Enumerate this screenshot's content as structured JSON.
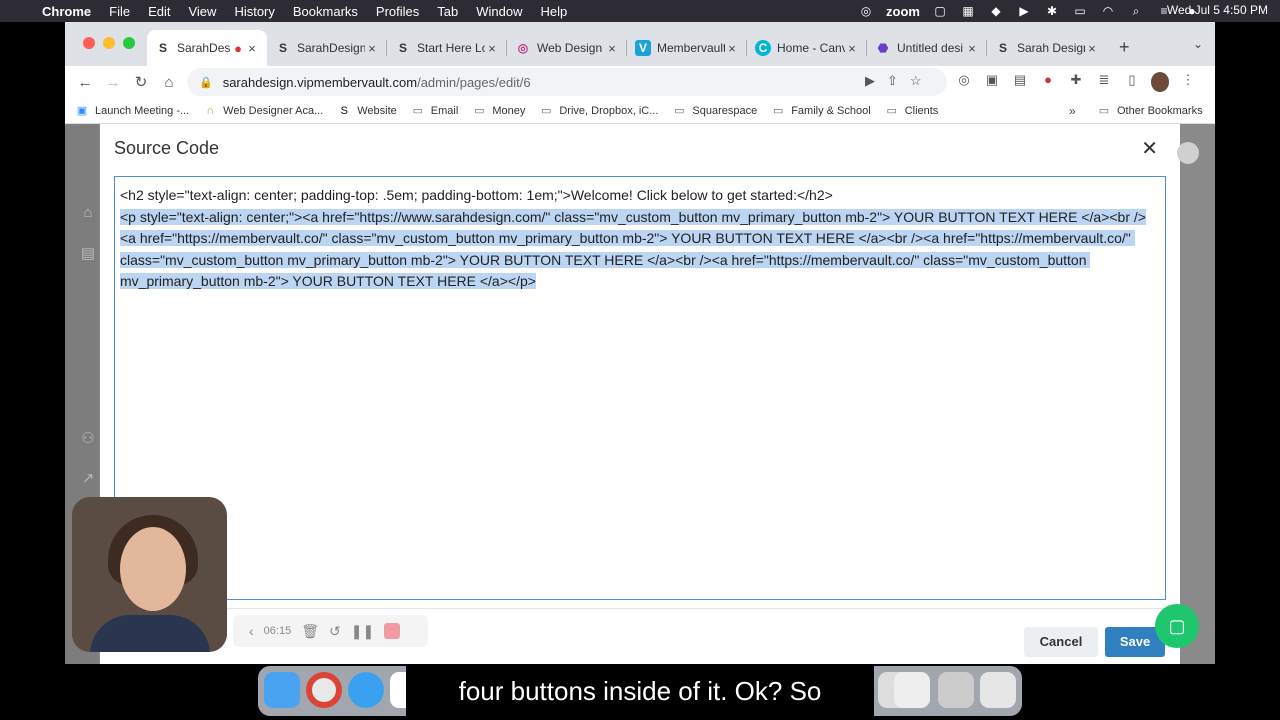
{
  "menubar": {
    "app": "Chrome",
    "items": [
      "File",
      "Edit",
      "View",
      "History",
      "Bookmarks",
      "Profiles",
      "Tab",
      "Window",
      "Help"
    ],
    "zoom": "zoom",
    "clock": "Wed Jul 5  4:50 PM"
  },
  "tabs": [
    {
      "label": "SarahDesign",
      "icon": "S"
    },
    {
      "label": "SarahDesign",
      "icon": "S"
    },
    {
      "label": "Start Here Lo",
      "icon": "S"
    },
    {
      "label": "Web Design",
      "icon": "◎"
    },
    {
      "label": "Membervault",
      "icon": "V"
    },
    {
      "label": "Home - Canva",
      "icon": "C"
    },
    {
      "label": "Untitled desi",
      "icon": "⬣"
    },
    {
      "label": "Sarah Design",
      "icon": "S"
    }
  ],
  "address": {
    "host": "sarahdesign.vipmembervault.com",
    "path": "/admin/pages/edit/6"
  },
  "bookmarks": [
    {
      "label": "Launch Meeting -...",
      "icon": "▣"
    },
    {
      "label": "Web Designer Aca...",
      "icon": "∩"
    },
    {
      "label": "Website",
      "icon": "S"
    },
    {
      "label": "Email",
      "icon": "▭"
    },
    {
      "label": "Money",
      "icon": "▭"
    },
    {
      "label": "Drive, Dropbox, iC...",
      "icon": "▭"
    },
    {
      "label": "Squarespace",
      "icon": "▭"
    },
    {
      "label": "Family & School",
      "icon": "▭"
    },
    {
      "label": "Clients",
      "icon": "▭"
    }
  ],
  "bookmarks_more": "»",
  "bookmarks_other": "Other Bookmarks",
  "modal": {
    "title": "Source Code",
    "close": "✕",
    "code_line1": "<h2 style=\"text-align: center; padding-top: .5em; padding-bottom: 1em;\">Welcome! Click below to get started:</h2>",
    "code_selected": "<p style=\"text-align: center;\"><a href=\"https://www.sarahdesign.com/\" class=\"mv_custom_button mv_primary_button mb-2\"> YOUR BUTTON TEXT HERE </a><br /><a href=\"https://membervault.co/\" class=\"mv_custom_button mv_primary_button mb-2\"> YOUR BUTTON TEXT HERE </a><br /><a href=\"https://membervault.co/\" class=\"mv_custom_button mv_primary_button mb-2\"> YOUR BUTTON TEXT HERE </a><br /><a href=\"https://membervault.co/\" class=\"mv_custom_button mv_primary_button mb-2\"> YOUR BUTTON TEXT HERE </a></p>",
    "cancel": "Cancel",
    "save": "Save"
  },
  "recorder": {
    "time": "06:15"
  },
  "caption": "four buttons inside of it. Ok? So"
}
